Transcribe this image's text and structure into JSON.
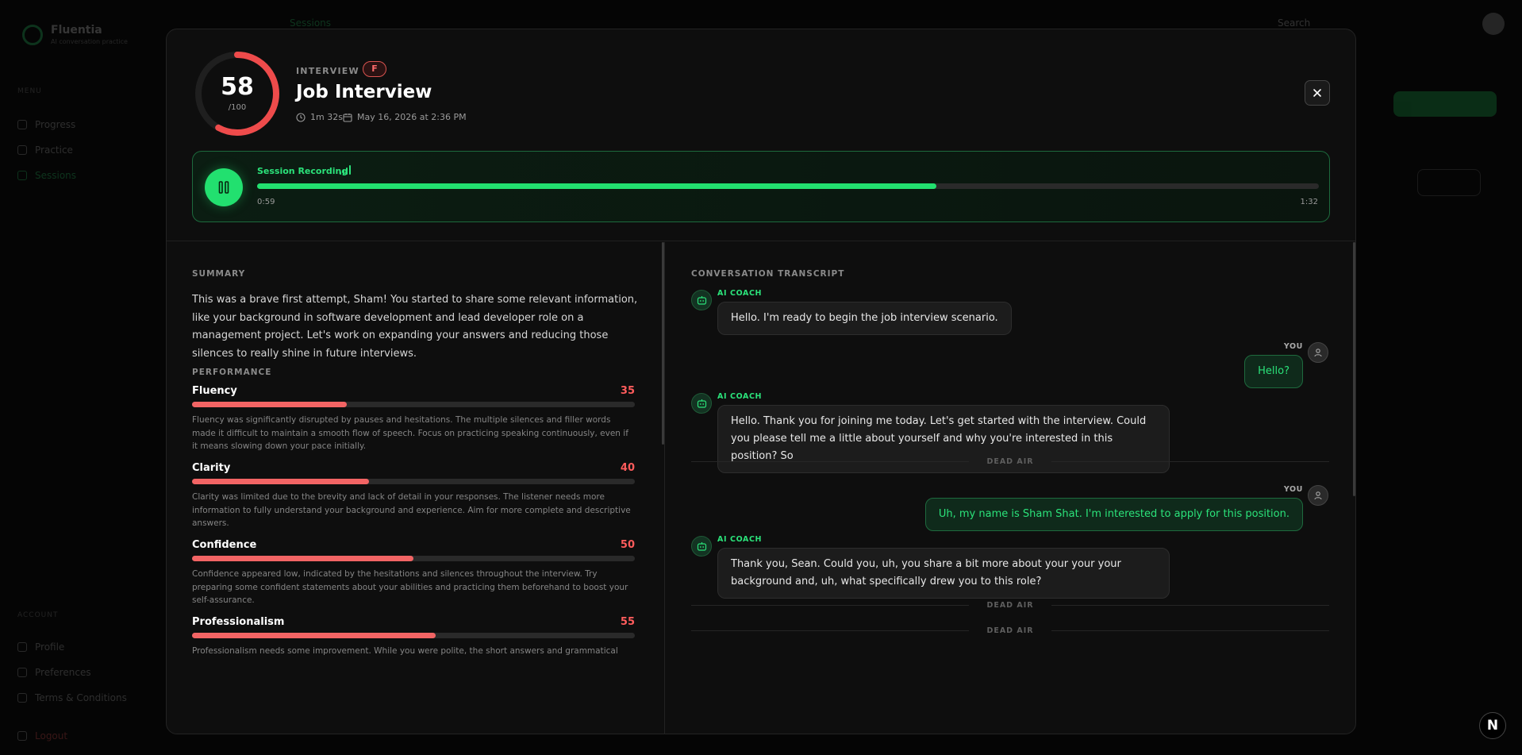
{
  "background": {
    "brand_name": "Fluentia",
    "brand_sub": "AI conversation practice",
    "section_main": "MENU",
    "nav": [
      "Progress",
      "Practice",
      "Sessions"
    ],
    "section_account": "ACCOUNT",
    "account_nav": [
      "Profile",
      "Preferences",
      "Terms & Conditions"
    ],
    "logout": "Logout",
    "breadcrumb": "Sessions",
    "search": "Search"
  },
  "session": {
    "score": "58",
    "score_max": "/100",
    "score_fraction": 0.58,
    "type_label": "INTERVIEW",
    "grade": "F",
    "title": "Job Interview",
    "duration": "1m 32s",
    "date": "May 16, 2026 at 2:36 PM"
  },
  "player": {
    "label": "Session Recording",
    "current_time": "0:59",
    "total_time": "1:32",
    "progress_fraction": 0.64
  },
  "summary": {
    "heading": "SUMMARY",
    "text": "This was a brave first attempt, Sham! You started to share some relevant information, like your background in software development and lead developer role on a management project. Let's work on expanding your answers and reducing those silences to really shine in future interviews."
  },
  "performance": {
    "heading": "PERFORMANCE",
    "metrics": [
      {
        "name": "Fluency",
        "score": "35",
        "fraction": 0.35,
        "desc": "Fluency was significantly disrupted by pauses and hesitations. The multiple silences and filler words made it difficult to maintain a smooth flow of speech. Focus on practicing speaking continuously, even if it means slowing down your pace initially."
      },
      {
        "name": "Clarity",
        "score": "40",
        "fraction": 0.4,
        "desc": "Clarity was limited due to the brevity and lack of detail in your responses. The listener needs more information to fully understand your background and experience. Aim for more complete and descriptive answers."
      },
      {
        "name": "Confidence",
        "score": "50",
        "fraction": 0.5,
        "desc": "Confidence appeared low, indicated by the hesitations and silences throughout the interview. Try preparing some confident statements about your abilities and practicing them beforehand to boost your self-assurance."
      },
      {
        "name": "Professionalism",
        "score": "55",
        "fraction": 0.55,
        "desc": "Professionalism needs some improvement. While you were polite, the short answers and grammatical"
      }
    ]
  },
  "transcript": {
    "heading": "CONVERSATION TRANSCRIPT",
    "coach_label": "AI COACH",
    "you_label": "YOU",
    "dead_air_label": "DEAD AIR",
    "messages": [
      {
        "text": "Hello. I'm ready to begin the job interview scenario."
      },
      {
        "text": "Hello?"
      },
      {
        "text": "Hello. Thank you for joining me today. Let's get started with the interview. Could you please tell me a little about yourself and why you're interested in this position? So"
      },
      {
        "text": "Uh, my name is Sham Shat. I'm interested to apply for this position."
      },
      {
        "text": "Thank you, Sean. Could you, uh, you share a bit more about your your your background and, uh, what specifically drew you to this role?"
      }
    ]
  },
  "colors": {
    "accent_green": "#22e06f",
    "score_red": "#f26464",
    "background": "#0e0e0e"
  },
  "icons": [
    "close-icon",
    "pause-icon",
    "clock-icon",
    "calendar-icon",
    "bot-icon",
    "user-icon",
    "signal-icon"
  ],
  "corner_badge": "N"
}
